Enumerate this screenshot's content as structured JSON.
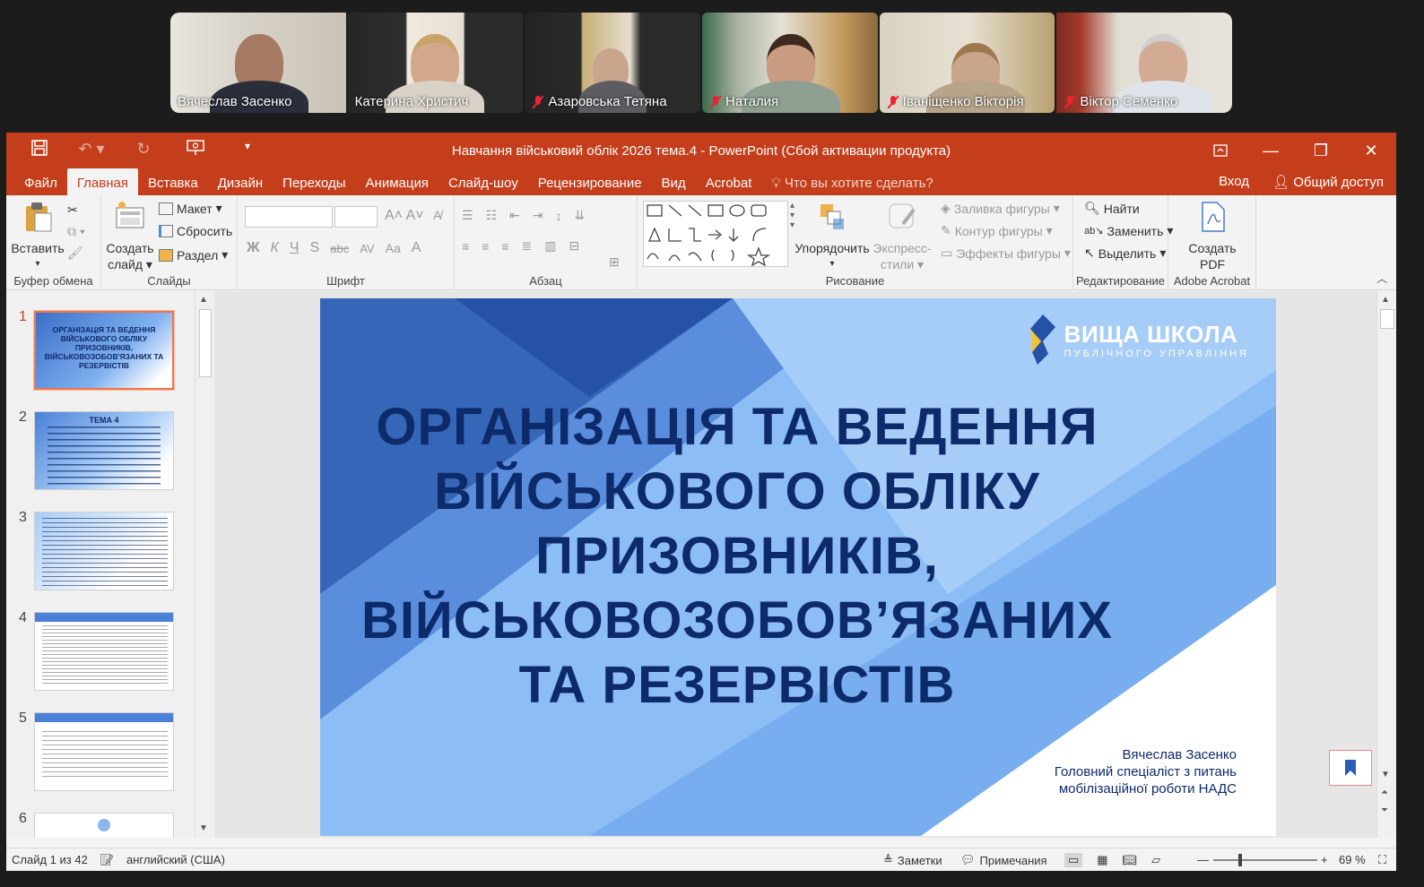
{
  "participants": [
    {
      "name": "Вячеслав Засенко",
      "muted": false,
      "active": false
    },
    {
      "name": "Катерина Христич",
      "muted": false,
      "active": true
    },
    {
      "name": "Азаровська Тетяна",
      "muted": true,
      "active": false
    },
    {
      "name": "Наталия",
      "muted": true,
      "active": false
    },
    {
      "name": "Іваніщенко Вікторія",
      "muted": true,
      "active": false
    },
    {
      "name": "Віктор Семенко",
      "muted": true,
      "active": false
    }
  ],
  "window": {
    "title": "Навчання військовий облік 2026 тема.4 - PowerPoint (Сбой активации продукта)"
  },
  "tabs": [
    "Файл",
    "Главная",
    "Вставка",
    "Дизайн",
    "Переходы",
    "Анимация",
    "Слайд-шоу",
    "Рецензирование",
    "Вид",
    "Acrobat"
  ],
  "active_tab": "Главная",
  "search_placeholder": "Что вы хотите сделать?",
  "account": {
    "signin": "Вход",
    "share": "Общий доступ"
  },
  "ribbon": {
    "clipboard": {
      "paste": "Вставить",
      "label": "Буфер обмена"
    },
    "slides": {
      "new_slide_1": "Создать",
      "new_slide_2": "слайд",
      "layout": "Макет",
      "reset": "Сбросить",
      "section": "Раздел",
      "label": "Слайды"
    },
    "font": {
      "label": "Шрифт",
      "bold": "Ж",
      "italic": "К",
      "underline": "Ч",
      "shadow": "S",
      "strike": "abc",
      "spacing": "AV",
      "case": "Aa"
    },
    "paragraph": {
      "label": "Абзац"
    },
    "drawing": {
      "arrange_1": "Упорядочить",
      "quick_styles_1": "Экспресс-",
      "quick_styles_2": "стили",
      "fill": "Заливка фигуры",
      "outline": "Контур фигуры",
      "effects": "Эффекты фигуры",
      "label": "Рисование"
    },
    "editing": {
      "find": "Найти",
      "replace": "Заменить",
      "select": "Выделить",
      "label": "Редактирование"
    },
    "acrobat": {
      "create_1": "Создать",
      "create_2": "PDF",
      "label": "Adobe Acrobat"
    }
  },
  "thumbnails": [
    {
      "num": "1",
      "text": "ОРГАНІЗАЦІЯ ТА ВЕДЕННЯ ВІЙСЬКОВОГО ОБЛІКУ ПРИЗОВНИКІВ, ВІЙСЬКОВОЗОБОВ'ЯЗАНИХ ТА РЕЗЕРВІСТІВ"
    },
    {
      "num": "2",
      "text": "ТЕМА 4"
    },
    {
      "num": "3",
      "text": ""
    },
    {
      "num": "4",
      "text": ""
    },
    {
      "num": "5",
      "text": ""
    },
    {
      "num": "6",
      "text": ""
    }
  ],
  "slide": {
    "title_lines": [
      "ОРГАНІЗАЦІЯ ТА ВЕДЕННЯ",
      "ВІЙСЬКОВОГО ОБЛІКУ",
      "ПРИЗОВНИКІВ,",
      "ВІЙСЬКОВОЗОБОВ’ЯЗАНИХ",
      "ТА РЕЗЕРВІСТІВ"
    ],
    "logo_main": "ВИЩА ШКОЛА",
    "logo_sub": "ПУБЛІЧНОГО УПРАВЛІННЯ",
    "author_lines": [
      "Вячеслав Засенко",
      "Головний спеціаліст з питань",
      "мобілізаційної роботи НАДС"
    ]
  },
  "status": {
    "slide_info": "Слайд 1 из 42",
    "language": "английский (США)",
    "notes": "Заметки",
    "comments": "Примечания",
    "zoom": "69 %"
  },
  "colors": {
    "accent": "#c43e1c",
    "slide_dark_blue": "#0d2a6a",
    "active_speaker": "#2ee66b"
  }
}
